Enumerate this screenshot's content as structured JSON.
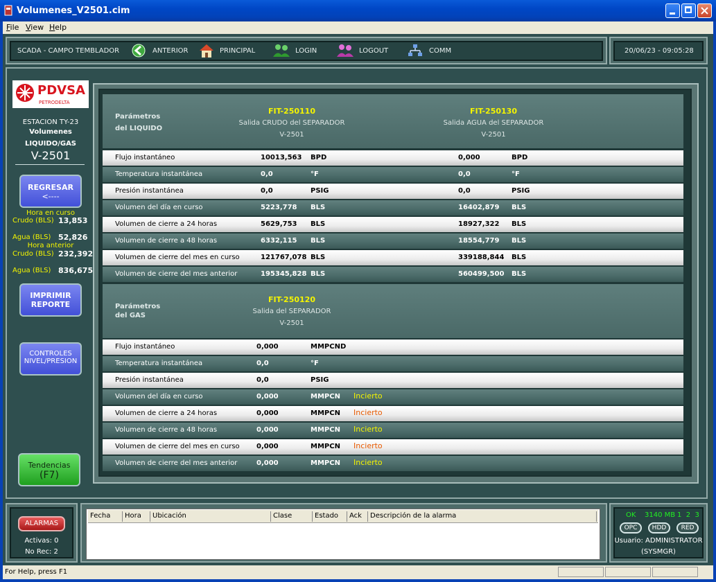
{
  "window": {
    "title": "Volumenes_V2501.cim"
  },
  "menu": [
    "File",
    "View",
    "Help"
  ],
  "toolbar": {
    "system": "SCADA - CAMPO TEMBLADOR",
    "nav": [
      {
        "label": "ANTERIOR",
        "icon": "back-arrow-icon"
      },
      {
        "label": "PRINCIPAL",
        "icon": "home-icon"
      },
      {
        "label": "LOGIN",
        "icon": "login-users-icon"
      },
      {
        "label": "LOGOUT",
        "icon": "logout-users-icon"
      },
      {
        "label": "COMM",
        "icon": "network-icon"
      }
    ],
    "datetime": "20/06/23 - 09:05:28"
  },
  "sidebar": {
    "logo_main": "PDVSA",
    "logo_sub": "PETRODELTA",
    "station": "ESTACION TY-23",
    "title1": "Volumenes",
    "title2": "LIQUIDO/GAS",
    "vessel": "V-2501",
    "btn_regresar_1": "REGRESAR",
    "btn_regresar_2": "<----",
    "hora_curso": "Hora en curso",
    "crudo_label": "Crudo (BLS)",
    "crudo_curso": "13,853",
    "agua_label": "Agua (BLS)",
    "agua_curso": "52,826",
    "hora_anterior": "Hora anterior",
    "crudo_anterior": "232,392",
    "agua_anterior": "836,675",
    "btn_imprimir_1": "IMPRIMIR",
    "btn_imprimir_2": "REPORTE",
    "btn_controles_1": "CONTROLES",
    "btn_controles_2": "NIVEL/PRESION",
    "btn_tendencias_1": "Tendencias",
    "btn_tendencias_2": "(F7)"
  },
  "liquid": {
    "params_1": "Parámetros",
    "params_2": "del LIQUIDO",
    "tag1": "FIT-250110",
    "tag1_desc": "Salida CRUDO del SEPARADOR",
    "tag1_vessel": "V-2501",
    "tag2": "FIT-250130",
    "tag2_desc": "Salida AGUA del SEPARADOR",
    "tag2_vessel": "V-2501",
    "rows": [
      {
        "label": "Flujo instantáneo",
        "v1": "10013,563",
        "u1": "BPD",
        "v2": "0,000",
        "u2": "BPD"
      },
      {
        "label": "Temperatura instantánea",
        "v1": "0,0",
        "u1": "°F",
        "v2": "0,0",
        "u2": "°F"
      },
      {
        "label": "Presión instantánea",
        "v1": "0,0",
        "u1": "PSIG",
        "v2": "0,0",
        "u2": "PSIG"
      },
      {
        "label": "Volumen del día en curso",
        "v1": "5223,778",
        "u1": "BLS",
        "v2": "16402,879",
        "u2": "BLS"
      },
      {
        "label": "Volumen de cierre a 24 horas",
        "v1": "5629,753",
        "u1": "BLS",
        "v2": "18927,322",
        "u2": "BLS"
      },
      {
        "label": "Volumen de cierre a 48 horas",
        "v1": "6332,115",
        "u1": "BLS",
        "v2": "18554,779",
        "u2": "BLS"
      },
      {
        "label": "Volumen de cierre del mes en curso",
        "v1": "121767,078",
        "u1": "BLS",
        "v2": "339188,844",
        "u2": "BLS"
      },
      {
        "label": "Volumen de cierre del mes anterior",
        "v1": "195345,828",
        "u1": "BLS",
        "v2": "560499,500",
        "u2": "BLS"
      }
    ]
  },
  "gas": {
    "params_1": "Parámetros",
    "params_2": "del GAS",
    "tag": "FIT-250120",
    "tag_desc": "Salida del SEPARADOR",
    "tag_vessel": "V-2501",
    "rows": [
      {
        "label": "Flujo instantáneo",
        "v": "0,000",
        "u": "MMPCND",
        "status": ""
      },
      {
        "label": "Temperatura instantánea",
        "v": "0,0",
        "u": "°F",
        "status": ""
      },
      {
        "label": "Presión instantánea",
        "v": "0,0",
        "u": "PSIG",
        "status": ""
      },
      {
        "label": "Volumen del día en curso",
        "v": "0,000",
        "u": "MMPCN",
        "status": "Incierto"
      },
      {
        "label": "Volumen de cierre a 24 horas",
        "v": "0,000",
        "u": "MMPCN",
        "status": "Incierto"
      },
      {
        "label": "Volumen de cierre a 48 horas",
        "v": "0,000",
        "u": "MMPCN",
        "status": "Incierto"
      },
      {
        "label": "Volumen de cierre del mes en curso",
        "v": "0,000",
        "u": "MMPCN",
        "status": "Incierto"
      },
      {
        "label": "Volumen de cierre del mes anterior",
        "v": "0,000",
        "u": "MMPCN",
        "status": "Incierto"
      }
    ]
  },
  "alarms": {
    "button": "ALARMAS",
    "activas": "Activas: 0",
    "norec": "No Rec: 2",
    "columns": [
      "Fecha",
      "Hora",
      "Ubicación",
      "Clase",
      "Estado",
      "Ack",
      "Descripción de la alarma"
    ]
  },
  "sysinfo": {
    "ok": "OK",
    "mem": "3140 MB",
    "nums": "1  2  3",
    "btn_opc": "OPC",
    "btn_hdd": "HDD",
    "btn_red": "RED",
    "user": "Usuario: ADMINISTRATOR",
    "group": "(SYSMGR)"
  },
  "statusbar": {
    "help": "For Help, press F1"
  },
  "colors": {
    "background": "#2f4f4f",
    "panel": "#4d6b69",
    "tag_yellow": "#f4f400",
    "status_incierto_light": "#e85a00",
    "status_incierto_dark": "#f4f400",
    "ok_green": "#22ee22"
  }
}
